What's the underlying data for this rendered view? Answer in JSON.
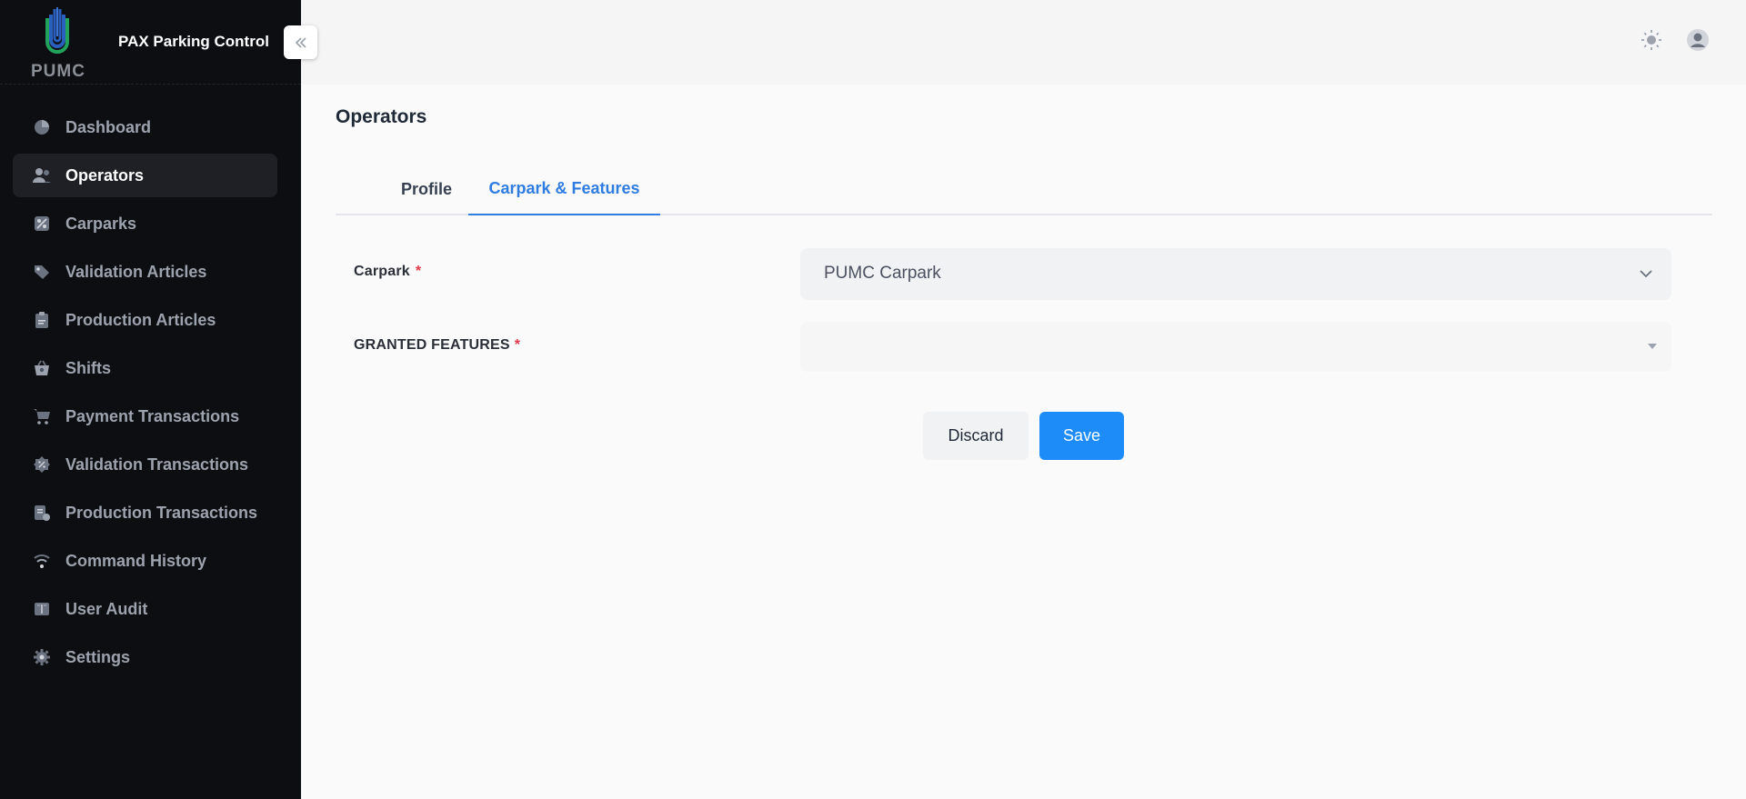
{
  "app": {
    "logo_text": "PUMC",
    "title": "PAX Parking Control"
  },
  "sidebar": {
    "items": [
      {
        "label": "Dashboard",
        "icon": "pie-chart-icon",
        "active": false
      },
      {
        "label": "Operators",
        "icon": "users-icon",
        "active": true
      },
      {
        "label": "Carparks",
        "icon": "percent-tag-icon",
        "active": false
      },
      {
        "label": "Validation Articles",
        "icon": "price-tag-icon",
        "active": false
      },
      {
        "label": "Production Articles",
        "icon": "clipboard-icon",
        "active": false
      },
      {
        "label": "Shifts",
        "icon": "basket-icon",
        "active": false
      },
      {
        "label": "Payment Transactions",
        "icon": "cart-icon",
        "active": false
      },
      {
        "label": "Validation Transactions",
        "icon": "badge-percent-icon",
        "active": false
      },
      {
        "label": "Production Transactions",
        "icon": "document-icon",
        "active": false
      },
      {
        "label": "Command History",
        "icon": "wifi-icon",
        "active": false
      },
      {
        "label": "User Audit",
        "icon": "book-icon",
        "active": false
      },
      {
        "label": "Settings",
        "icon": "gear-icon",
        "active": false
      }
    ]
  },
  "header": {
    "theme_icon": "sun-icon",
    "user_icon": "user-avatar-icon"
  },
  "main": {
    "page_title": "Operators",
    "tabs": [
      {
        "label": "Profile",
        "active": false
      },
      {
        "label": "Carpark & Features",
        "active": true
      }
    ],
    "form": {
      "carpark_label": "Carpark",
      "carpark_value": "PUMC Carpark",
      "features_label": "GRANTED FEATURES",
      "features_value": "",
      "required_mark": "*"
    },
    "buttons": {
      "discard": "Discard",
      "save": "Save"
    }
  },
  "colors": {
    "accent": "#2f7de1",
    "save": "#1d8cf8",
    "sidebar_bg": "#0d0e12",
    "required": "#e0394a"
  }
}
